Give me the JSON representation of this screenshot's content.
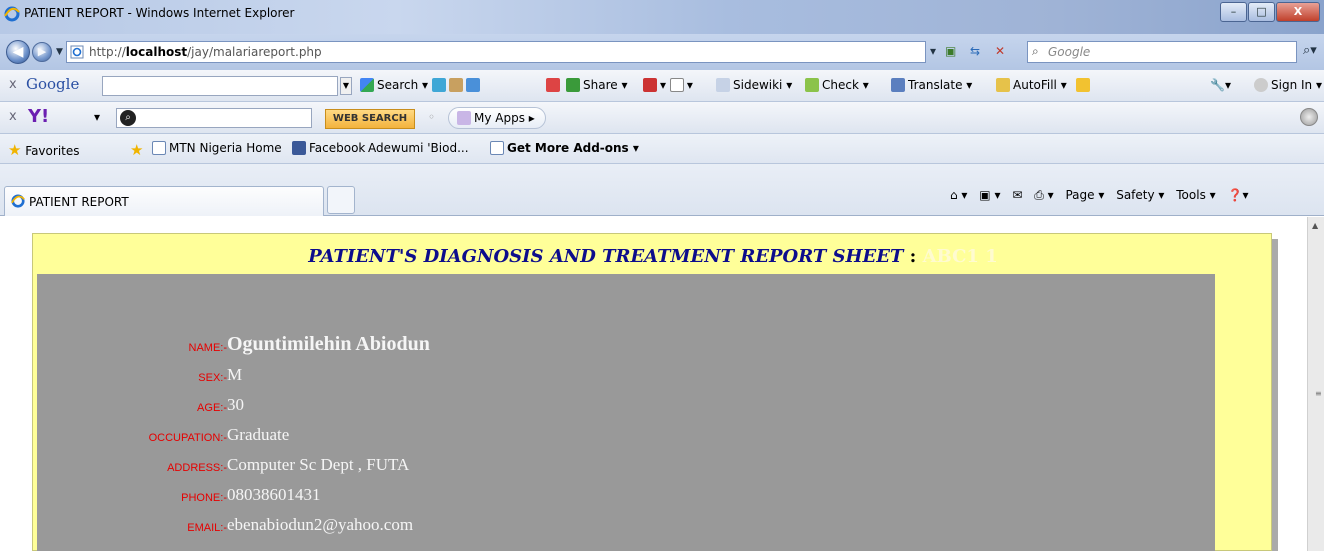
{
  "window": {
    "title": "PATIENT REPORT - Windows Internet Explorer",
    "buttons": [
      "–",
      "□",
      "X"
    ]
  },
  "address_bar": {
    "url_prefix": "http://",
    "url_host": "localhost",
    "url_path": "/jay/malariareport.php",
    "search_placeholder": "Google"
  },
  "google_toolbar": {
    "logo": "Google",
    "items": [
      "Search ▾",
      "Share ▾",
      "Sidewiki ▾",
      "Check ▾",
      "Translate ▾",
      "AutoFill ▾"
    ],
    "sign_in": "Sign In ▾"
  },
  "yahoo_toolbar": {
    "logo": "Y!",
    "search_button": "WEB SEARCH",
    "my_apps": "My Apps"
  },
  "favorites_bar": {
    "favorites": "Favorites",
    "items": [
      "MTN Nigeria Home",
      "Facebook",
      "Adewumi 'Biod...",
      "Get More Add-ons ▾"
    ]
  },
  "tab": {
    "title": "PATIENT REPORT"
  },
  "command_bar": {
    "items": [
      "Page ▾",
      "Safety ▾",
      "Tools ▾"
    ]
  },
  "report": {
    "title": "PATIENT'S DIAGNOSIS AND TREATMENT REPORT SHEET",
    "separator": ":",
    "id_text": "ABC1 1",
    "fields": [
      {
        "label": "NAME:-",
        "value": "Oguntimilehin Abiodun"
      },
      {
        "label": "SEX:-",
        "value": "M"
      },
      {
        "label": "AGE:-",
        "value": "30"
      },
      {
        "label": "OCCUPATION:-",
        "value": "Graduate"
      },
      {
        "label": "ADDRESS:-",
        "value": "Computer Sc Dept , FUTA"
      },
      {
        "label": "PHONE:-",
        "value": "08038601431"
      },
      {
        "label": "EMAIL:-",
        "value": "ebenabiodun2@yahoo.com"
      }
    ]
  },
  "colors": {
    "sheet_bg": "#ffff99",
    "panel_bg": "#999999",
    "label": "#e60000",
    "title": "#0d0d8c"
  }
}
